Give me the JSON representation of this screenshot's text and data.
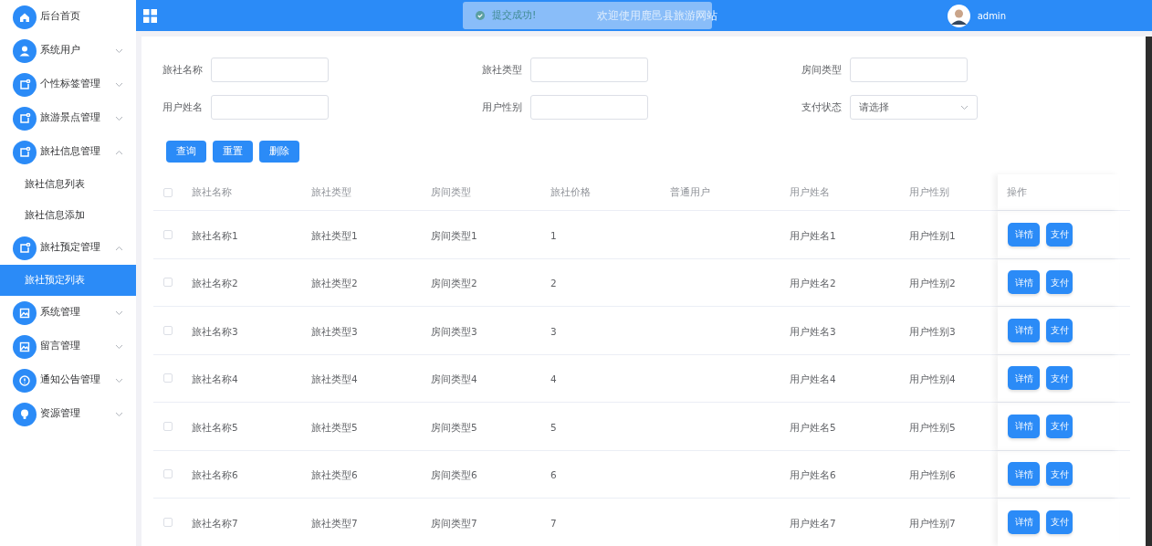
{
  "sidebar": {
    "items": [
      {
        "label": "后台首页",
        "expandable": false
      },
      {
        "label": "系统用户",
        "expandable": true,
        "expanded": false
      },
      {
        "label": "个性标签管理",
        "expandable": true,
        "expanded": false
      },
      {
        "label": "旅游景点管理",
        "expandable": true,
        "expanded": false
      },
      {
        "label": "旅社信息管理",
        "expandable": true,
        "expanded": true,
        "children": [
          {
            "label": "旅社信息列表",
            "selected": false
          },
          {
            "label": "旅社信息添加",
            "selected": false
          }
        ]
      },
      {
        "label": "旅社预定管理",
        "expandable": true,
        "expanded": true,
        "children": [
          {
            "label": "旅社预定列表",
            "selected": true
          }
        ]
      },
      {
        "label": "系统管理",
        "expandable": true,
        "expanded": false
      },
      {
        "label": "留言管理",
        "expandable": true,
        "expanded": false
      },
      {
        "label": "通知公告管理",
        "expandable": true,
        "expanded": false
      },
      {
        "label": "资源管理",
        "expandable": true,
        "expanded": false
      }
    ]
  },
  "header": {
    "title": "欢迎使用鹿邑县旅游网站",
    "user": "admin"
  },
  "toast": {
    "message": "提交成功!"
  },
  "filters": [
    {
      "label": "旅社名称",
      "kind": "input"
    },
    {
      "label": "旅社类型",
      "kind": "input"
    },
    {
      "label": "房间类型",
      "kind": "input"
    },
    {
      "label": "用户姓名",
      "kind": "input"
    },
    {
      "label": "用户性别",
      "kind": "input"
    },
    {
      "label": "支付状态",
      "kind": "select",
      "placeholder": "请选择"
    }
  ],
  "buttons": [
    "查询",
    "重置",
    "删除"
  ],
  "table": {
    "header_checked": false,
    "columns": [
      "旅社名称",
      "旅社类型",
      "房间类型",
      "旅社价格",
      "普通用户",
      "用户姓名",
      "用户性别",
      "操作"
    ],
    "rows": [
      {
        "checked": false,
        "cells": [
          "旅社名称1",
          "旅社类型1",
          "房间类型1",
          "1",
          "",
          "用户姓名1",
          "用户性别1"
        ],
        "actions": [
          "详情",
          "支付"
        ]
      },
      {
        "checked": false,
        "cells": [
          "旅社名称2",
          "旅社类型2",
          "房间类型2",
          "2",
          "",
          "用户姓名2",
          "用户性别2"
        ],
        "actions": [
          "详情",
          "支付"
        ]
      },
      {
        "checked": false,
        "cells": [
          "旅社名称3",
          "旅社类型3",
          "房间类型3",
          "3",
          "",
          "用户姓名3",
          "用户性别3"
        ],
        "actions": [
          "详情",
          "支付"
        ]
      },
      {
        "checked": false,
        "cells": [
          "旅社名称4",
          "旅社类型4",
          "房间类型4",
          "4",
          "",
          "用户姓名4",
          "用户性别4"
        ],
        "actions": [
          "详情",
          "支付"
        ]
      },
      {
        "checked": false,
        "cells": [
          "旅社名称5",
          "旅社类型5",
          "房间类型5",
          "5",
          "",
          "用户姓名5",
          "用户性别5"
        ],
        "actions": [
          "详情",
          "支付"
        ]
      },
      {
        "checked": false,
        "cells": [
          "旅社名称6",
          "旅社类型6",
          "房间类型6",
          "6",
          "",
          "用户姓名6",
          "用户性别6"
        ],
        "actions": [
          "详情",
          "支付"
        ]
      },
      {
        "checked": false,
        "cells": [
          "旅社名称7",
          "旅社类型7",
          "房间类型7",
          "7",
          "",
          "用户姓名7",
          "用户性别7"
        ],
        "actions": [
          "详情",
          "支付"
        ]
      }
    ]
  }
}
